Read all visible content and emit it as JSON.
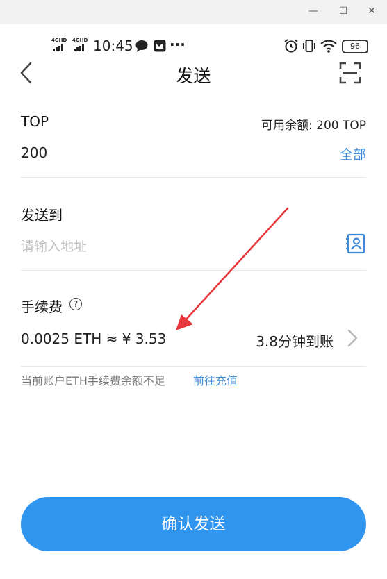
{
  "window": {
    "minimize_glyph": "—",
    "maximize_glyph": "☐",
    "close_glyph": "✕"
  },
  "statusbar": {
    "signal1_label": "4GHD",
    "signal2_label": "4GHD",
    "time": "10:45",
    "more_glyph": "···",
    "battery": "96"
  },
  "header": {
    "title": "发送"
  },
  "token": {
    "name": "TOP",
    "balance": "可用余额: 200 TOP",
    "amount": "200",
    "all_label": "全部"
  },
  "recipient": {
    "label": "发送到",
    "placeholder": "请输入地址"
  },
  "fee": {
    "label": "手续费",
    "help_glyph": "?",
    "amount": "0.0025 ETH ≈ ¥  3.53",
    "arrival": "3.8分钟到账",
    "warning": "当前账户ETH手续费余额不足",
    "recharge_link": "前往充值"
  },
  "actions": {
    "confirm_label": "确认发送"
  },
  "colors": {
    "accent": "#2f95ef",
    "link": "#3d8ad8",
    "annotation_arrow": "#e8383d"
  }
}
